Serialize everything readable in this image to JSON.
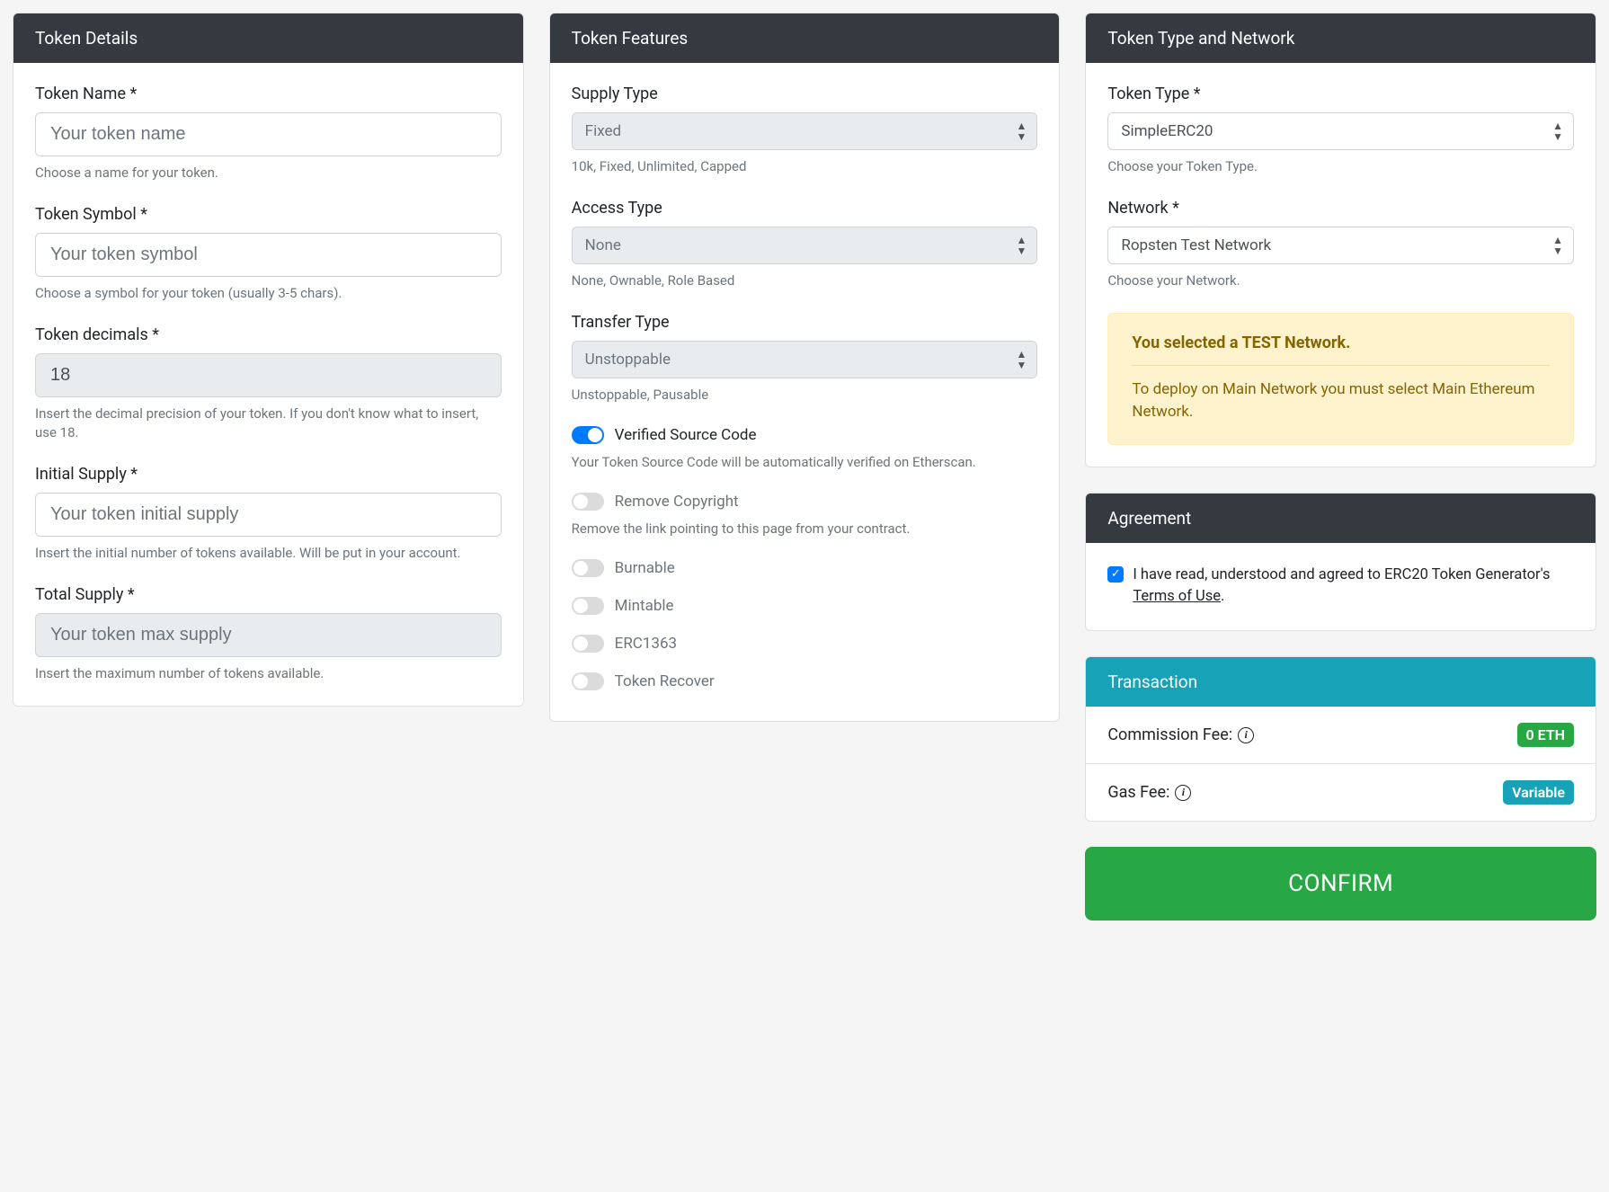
{
  "details": {
    "header": "Token Details",
    "name": {
      "label": "Token Name *",
      "placeholder": "Your token name",
      "help": "Choose a name for your token."
    },
    "symbol": {
      "label": "Token Symbol *",
      "placeholder": "Your token symbol",
      "help": "Choose a symbol for your token (usually 3-5 chars)."
    },
    "decimals": {
      "label": "Token decimals *",
      "value": "18",
      "help": "Insert the decimal precision of your token. If you don't know what to insert, use 18."
    },
    "initial": {
      "label": "Initial Supply *",
      "placeholder": "Your token initial supply",
      "help": "Insert the initial number of tokens available. Will be put in your account."
    },
    "total": {
      "label": "Total Supply *",
      "placeholder": "Your token max supply",
      "help": "Insert the maximum number of tokens available."
    }
  },
  "features": {
    "header": "Token Features",
    "supply": {
      "label": "Supply Type",
      "value": "Fixed",
      "help": "10k, Fixed, Unlimited, Capped"
    },
    "access": {
      "label": "Access Type",
      "value": "None",
      "help": "None, Ownable, Role Based"
    },
    "transfer": {
      "label": "Transfer Type",
      "value": "Unstoppable",
      "help": "Unstoppable, Pausable"
    },
    "verified": {
      "label": "Verified Source Code",
      "help": "Your Token Source Code will be automatically verified on Etherscan."
    },
    "copyright": {
      "label": "Remove Copyright",
      "help": "Remove the link pointing to this page from your contract."
    },
    "burnable": {
      "label": "Burnable"
    },
    "mintable": {
      "label": "Mintable"
    },
    "erc1363": {
      "label": "ERC1363"
    },
    "recover": {
      "label": "Token Recover"
    }
  },
  "typeNet": {
    "header": "Token Type and Network",
    "type": {
      "label": "Token Type *",
      "value": "SimpleERC20",
      "help": "Choose your Token Type."
    },
    "network": {
      "label": "Network *",
      "value": "Ropsten Test Network",
      "help": "Choose your Network."
    },
    "alert": {
      "title": "You selected a TEST Network.",
      "body": "To deploy on Main Network you must select Main Ethereum Network."
    }
  },
  "agreement": {
    "header": "Agreement",
    "text_pre": "I have read, understood and agreed to ERC20 Token Generator's ",
    "link": "Terms of Use",
    "text_post": "."
  },
  "transaction": {
    "header": "Transaction",
    "commission": {
      "label": "Commission Fee:",
      "badge": "0 ETH"
    },
    "gas": {
      "label": "Gas Fee:",
      "badge": "Variable"
    }
  },
  "confirm": "CONFIRM"
}
